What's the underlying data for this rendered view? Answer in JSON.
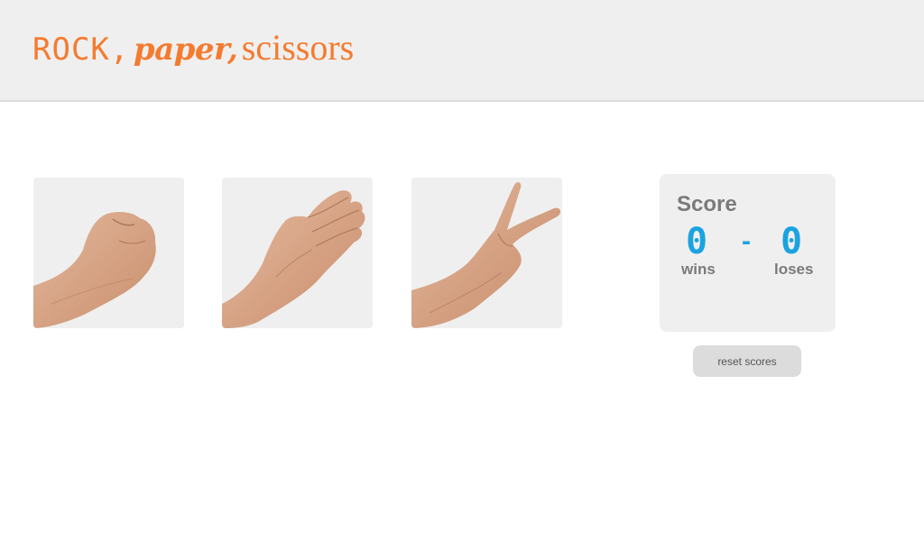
{
  "header": {
    "logo_rock": "ROCK,",
    "logo_paper": "paper,",
    "logo_scissors": "scissors"
  },
  "choices": [
    {
      "name": "rock",
      "icon": "rock-hand-icon"
    },
    {
      "name": "paper",
      "icon": "paper-hand-icon"
    },
    {
      "name": "scissors",
      "icon": "scissors-hand-icon"
    }
  ],
  "score": {
    "title": "Score",
    "wins": "0",
    "separator": "-",
    "loses": "0",
    "wins_label": "wins",
    "loses_label": "loses"
  },
  "reset_button": {
    "label": "reset scores"
  },
  "colors": {
    "brand_orange": "#f47b2f",
    "score_blue": "#1aa3e0",
    "panel_gray": "#efefef",
    "skin": "#d9a98a"
  }
}
